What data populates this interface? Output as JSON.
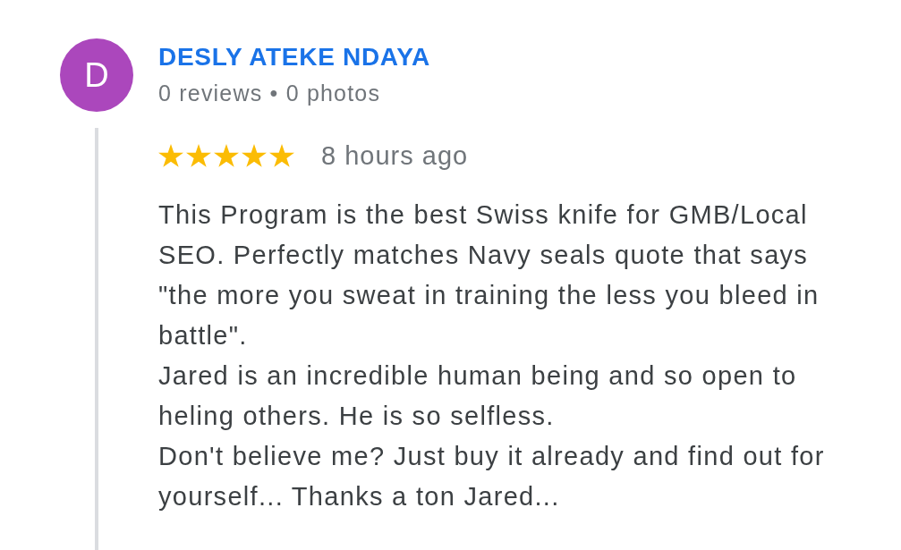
{
  "review": {
    "author": {
      "initial": "D",
      "name": "DESLY ATEKE NDAYA",
      "meta": "0 reviews • 0 photos"
    },
    "stars": 5,
    "time": "8 hours ago",
    "text": "This Program is the best Swiss knife for GMB/Local SEO. Perfectly matches Navy seals quote that says \"the more you sweat in training the less you bleed in battle\".\nJared is an incredible human being and so open to heling others. He is so selfless.\nDon't believe me? Just buy it already and find out for yourself... Thanks a ton Jared..."
  }
}
